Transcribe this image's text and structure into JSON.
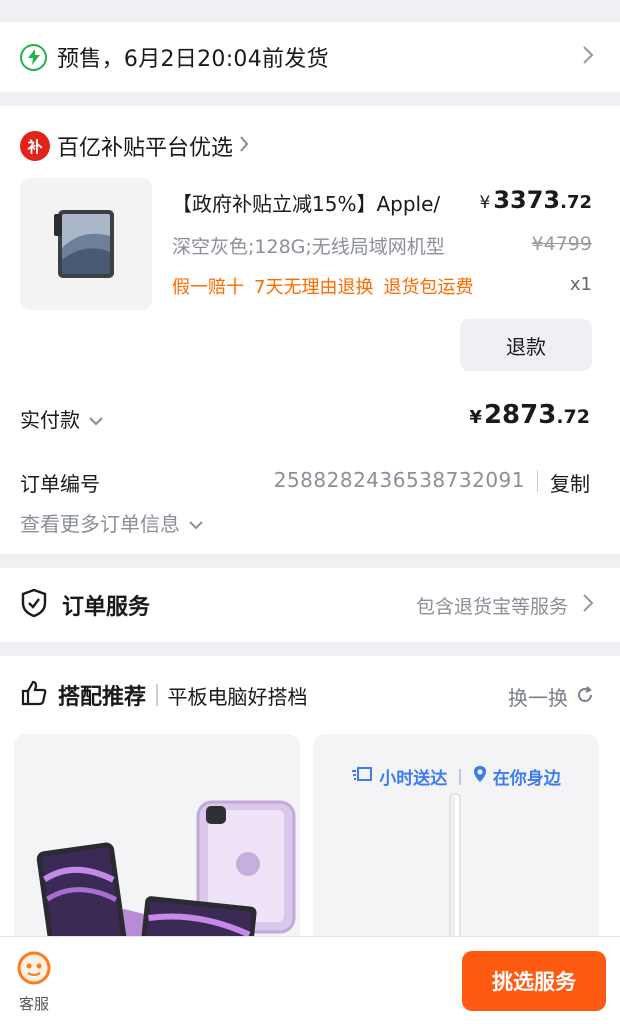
{
  "presale": {
    "icon": "lightning-icon",
    "text": "预售，6月2日20:04前发货"
  },
  "order": {
    "store": {
      "badge": "补",
      "name": "百亿补贴平台优选"
    },
    "product": {
      "title": "【政府补贴立减15%】Apple/",
      "price_symbol": "¥",
      "price_int": "3373",
      "price_dec": ".72",
      "variant": "深空灰色;128G;无线局域网机型",
      "original_price": "¥4799",
      "tags": [
        "假一赔十",
        "7天无理由退换",
        "退货包运费"
      ],
      "quantity": "x1"
    },
    "refund_label": "退款",
    "paid": {
      "label": "实付款",
      "symbol": "¥",
      "int": "2873",
      "dec": ".72"
    },
    "order_number": {
      "label": "订单编号",
      "value": "2588282436538732091",
      "copy_label": "复制"
    },
    "more_info_label": "查看更多订单信息"
  },
  "service": {
    "title": "订单服务",
    "desc": "包含退货宝等服务"
  },
  "recommend": {
    "title": "搭配推荐",
    "subtitle": "平板电脑好搭档",
    "swap_label": "换一换",
    "delivery": {
      "hours": "小时送达",
      "nearby": "在你身边"
    }
  },
  "bottom": {
    "cs_label": "客服",
    "pick_label": "挑选服务"
  },
  "colors": {
    "accent": "#ff5a12",
    "tag": "#ff6a00",
    "green": "#22b14c",
    "red_badge": "#e2231a",
    "blue": "#3d7cf0"
  }
}
